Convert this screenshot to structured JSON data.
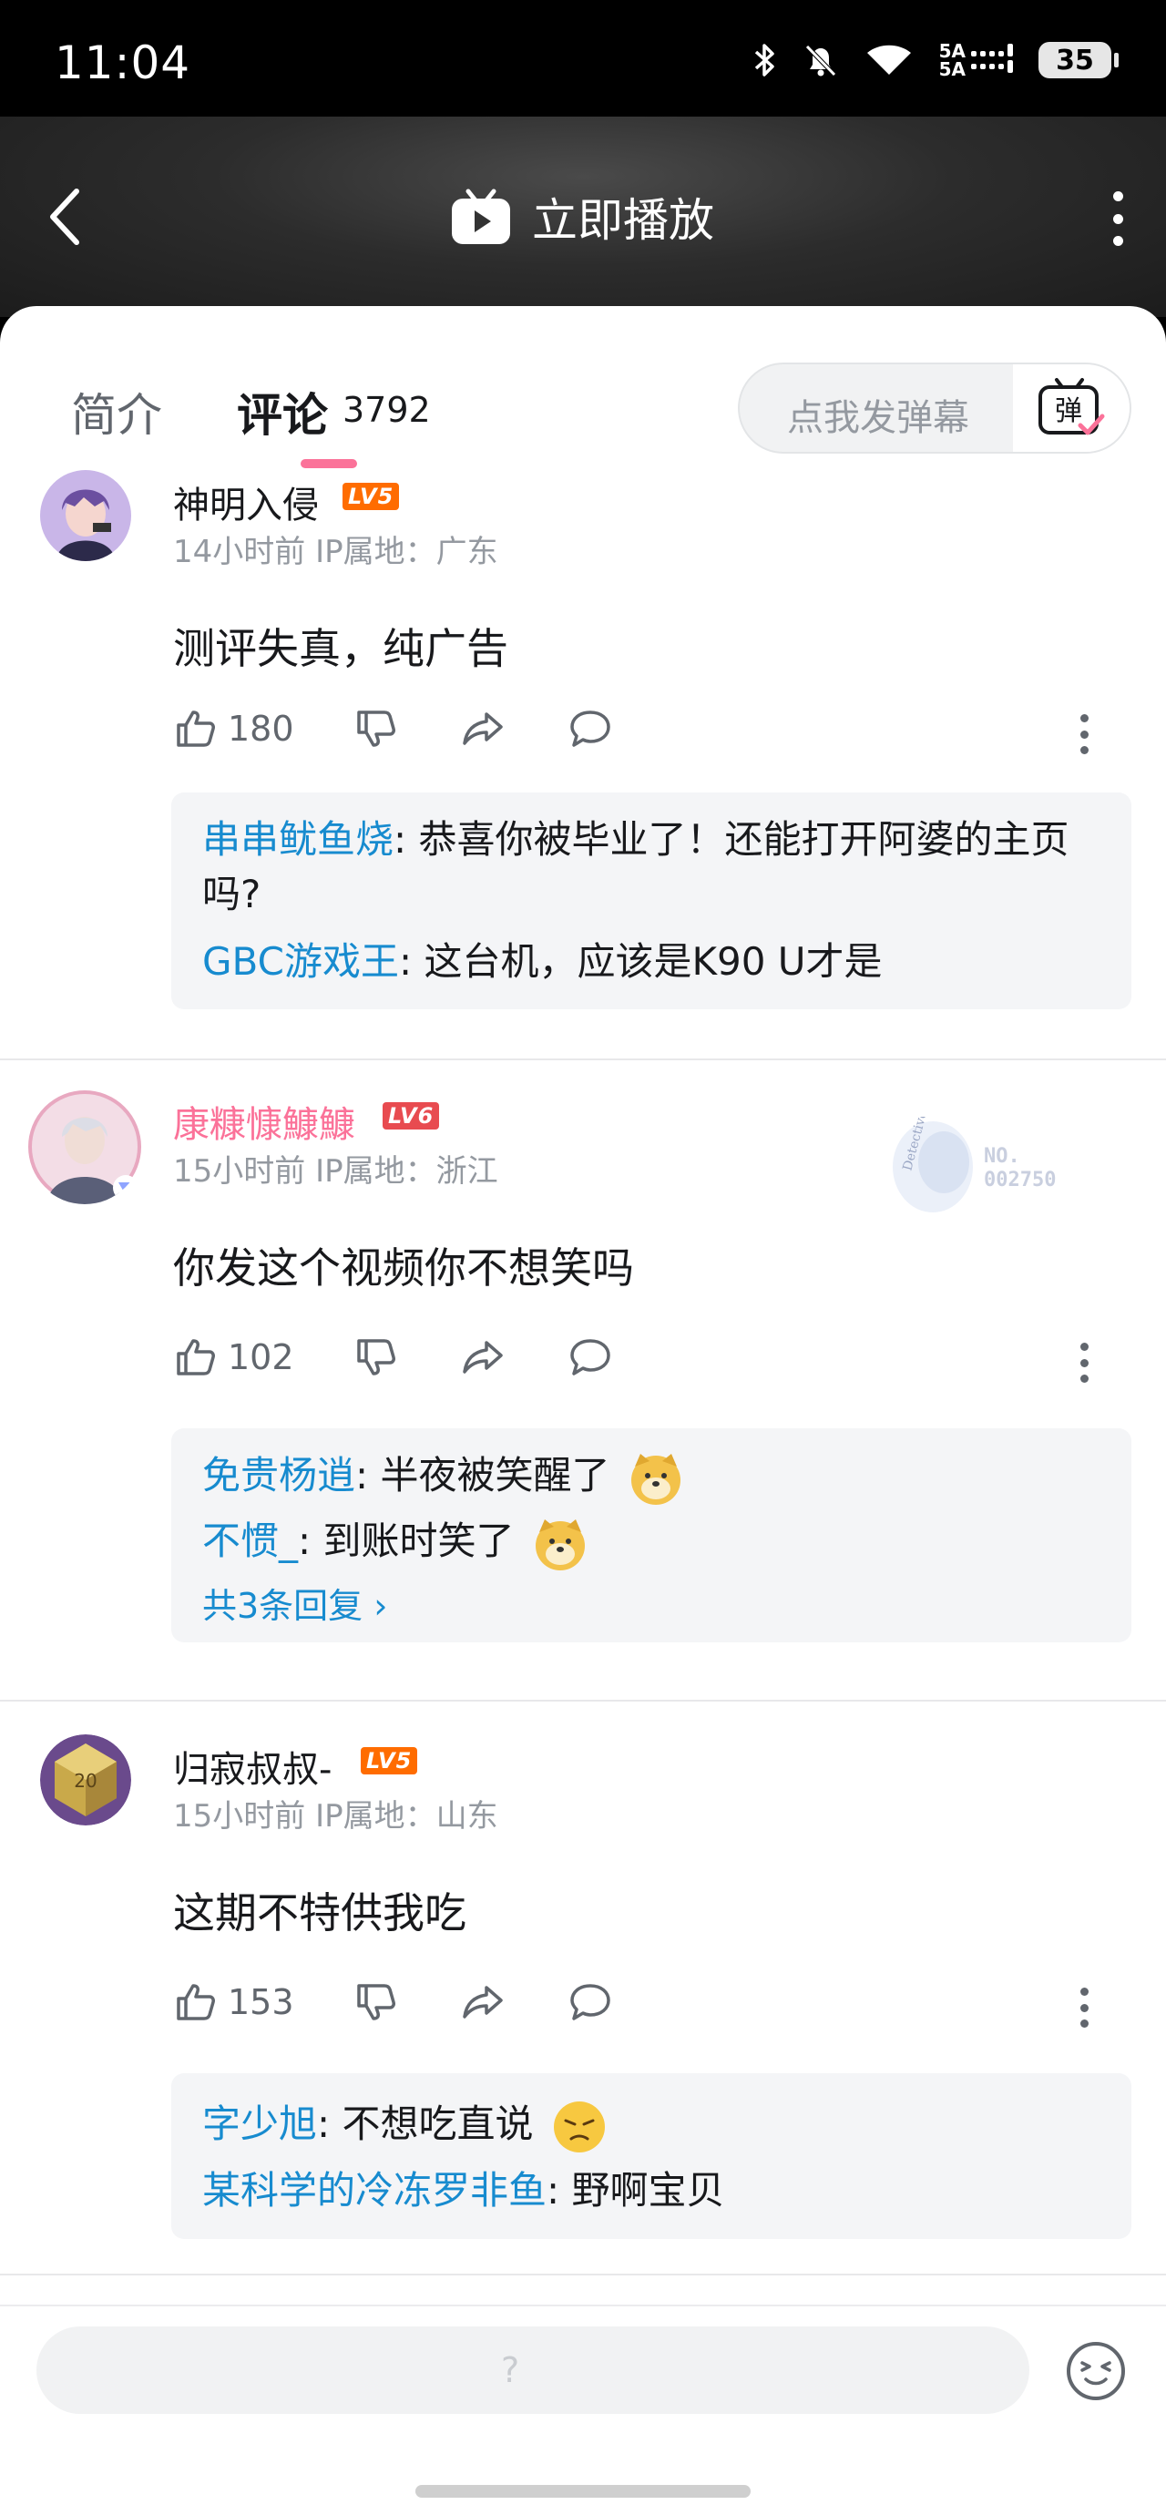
{
  "status": {
    "time": "11:04",
    "signal_label_1": "5A",
    "signal_label_2": "5A",
    "battery": "35"
  },
  "header": {
    "title": "立即播放"
  },
  "tabs": {
    "intro": "简介",
    "comments": "评论",
    "count": "3792"
  },
  "danmaku": {
    "placeholder": "点我发弹幕",
    "button_label": "弹"
  },
  "comments": [
    {
      "username": "神明入侵",
      "level": "LV5",
      "meta": "14小时前 IP属地：广东",
      "text": "测评失真，纯广告",
      "likes": "180",
      "replies": [
        {
          "name": "串串鱿鱼烧",
          "text": ": 恭喜你被毕业了！还能打开阿婆的主页吗?"
        },
        {
          "name": "GBC游戏王",
          "text": ": 这台机，应该是K90 U才是"
        }
      ]
    },
    {
      "username": "康糠慷鱇鱇",
      "level": "LV6",
      "meta": "15小时前 IP属地：浙江",
      "text": "你发这个视频你不想笑吗",
      "likes": "102",
      "fan_badge": {
        "text": "Detective Conan",
        "number": "NO.\n002750"
      },
      "replies": [
        {
          "name": "免贵杨逍",
          "text": ": 半夜被笑醒了"
        },
        {
          "name": "不惯_",
          "text": ": 到账时笑了"
        }
      ],
      "more_replies": "共3条回复 ›"
    },
    {
      "username": "归寂叔叔-",
      "level": "LV5",
      "meta": "15小时前 IP属地：山东",
      "text": "这期不特供我吃",
      "likes": "153",
      "replies": [
        {
          "name": "字少旭",
          "text": ": 不想吃直说"
        },
        {
          "name": "某科学的冷冻罗非鱼",
          "text": ": 野啊宝贝"
        }
      ]
    }
  ],
  "bottom": {
    "input_placeholder": "?"
  }
}
